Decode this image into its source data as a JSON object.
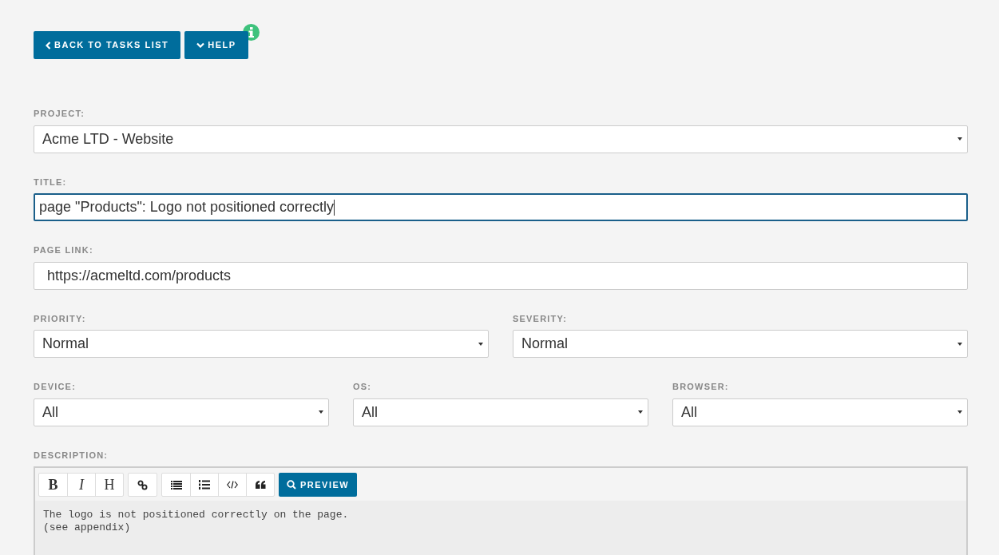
{
  "buttons": [
    {
      "kind": "back",
      "label": "BACK TO TASKS LIST"
    },
    {
      "kind": "help",
      "label": "HELP"
    }
  ],
  "rows": [
    {
      "fields": [
        {
          "kind": "select",
          "label": "PROJECT:",
          "value": "Acme LTD - Website"
        }
      ]
    },
    {
      "fields": [
        {
          "kind": "text",
          "label": "TITLE:",
          "value": "page \"Products\": Logo not positioned correctly",
          "focused": true
        }
      ]
    },
    {
      "fields": [
        {
          "kind": "text",
          "label": "PAGE LINK:",
          "value": "https://acmeltd.com/products",
          "focused": false
        }
      ]
    },
    {
      "fields": [
        {
          "kind": "select",
          "label": "PRIORITY:",
          "value": "Normal"
        },
        {
          "kind": "select",
          "label": "SEVERITY:",
          "value": "Normal"
        }
      ]
    },
    {
      "fields": [
        {
          "kind": "select",
          "label": "DEVICE:",
          "value": "All"
        },
        {
          "kind": "select",
          "label": "OS:",
          "value": "All"
        },
        {
          "kind": "select",
          "label": "BROWSER:",
          "value": "All"
        }
      ]
    }
  ],
  "description": {
    "label": "DESCRIPTION:",
    "toolbar": [
      [
        {
          "kind": "bold",
          "text": "B"
        },
        {
          "kind": "italic",
          "text": "I"
        },
        {
          "kind": "heading",
          "text": "H"
        }
      ],
      [
        {
          "kind": "link"
        }
      ],
      [
        {
          "kind": "list"
        },
        {
          "kind": "ordered-list"
        },
        {
          "kind": "code"
        },
        {
          "kind": "quote"
        }
      ]
    ],
    "preview": "PREVIEW",
    "lines": [
      "The logo is not positioned correctly on the page.",
      "(see appendix)"
    ]
  }
}
